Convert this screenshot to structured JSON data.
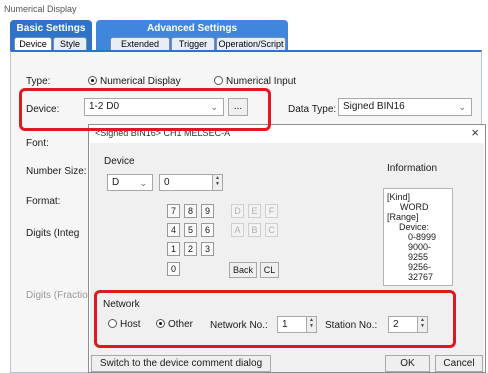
{
  "window": {
    "title": "Numerical Display"
  },
  "tabs": {
    "basic": {
      "label": "Basic Settings",
      "subtabs": [
        "Device",
        "Style"
      ]
    },
    "advanced": {
      "label": "Advanced Settings",
      "subtabs": [
        "Extended",
        "Trigger",
        "Operation/Script"
      ]
    }
  },
  "form": {
    "type_label": "Type:",
    "type_options": [
      "Numerical Display",
      "Numerical Input"
    ],
    "device_label": "Device:",
    "device_value": "1-2 D0",
    "browse_label": "...",
    "data_type_label": "Data Type:",
    "data_type_value": "Signed BIN16",
    "font_label": "Font:",
    "number_size_label": "Number Size:",
    "format_label": "Format:",
    "digits_integer_label": "Digits (Integ",
    "digits_fraction_label": "Digits (Fractio"
  },
  "dialog": {
    "title": "<Signed BIN16> CH1 MELSEC-A",
    "close_label": "×",
    "device_group": "Device",
    "device_type": "D",
    "device_number": "0",
    "keypad": [
      [
        "7",
        "8",
        "9",
        "D",
        "E",
        "F"
      ],
      [
        "4",
        "5",
        "6",
        "A",
        "B",
        "C"
      ],
      [
        "1",
        "2",
        "3"
      ],
      [
        "0"
      ]
    ],
    "back_label": "Back",
    "clear_label": "CL",
    "info_label": "Information",
    "info_lines": [
      "[Kind]",
      "WORD",
      "[Range]",
      "Device:",
      "0-8999",
      "9000-9255",
      "9256-32767"
    ],
    "network_group": "Network",
    "host_label": "Host",
    "other_label": "Other",
    "network_no_label": "Network No.:",
    "network_no_value": "1",
    "station_no_label": "Station No.:",
    "station_no_value": "2",
    "switch_label": "Switch to the device comment dialog",
    "ok_label": "OK",
    "cancel_label": "Cancel"
  },
  "colors": {
    "highlight": "#e0191e",
    "tab_basic": "#2f73c9",
    "tab_advanced": "#3f86dc"
  }
}
